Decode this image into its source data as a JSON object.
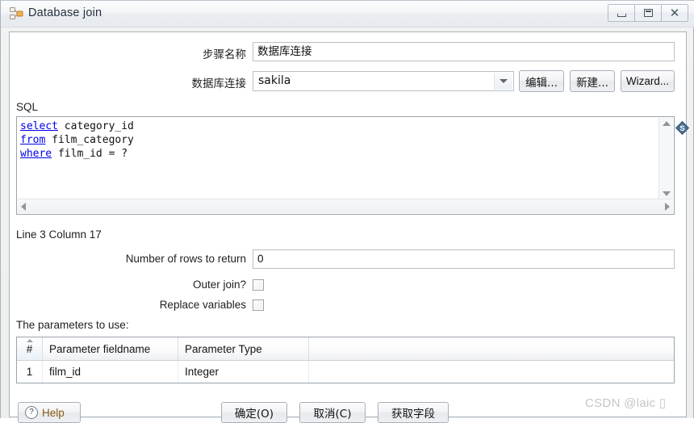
{
  "window": {
    "title": "Database join",
    "icon": "database-join-step-icon",
    "controls": [
      {
        "name": "minimize",
        "glyph": "—"
      },
      {
        "name": "maximize",
        "glyph": "□"
      },
      {
        "name": "close",
        "glyph": "✕"
      }
    ]
  },
  "form": {
    "step_name_label": "步骤名称",
    "step_name_value": "数据库连接",
    "connection_label": "数据库连接",
    "connection_value": "sakila",
    "connection_options": [
      "sakila"
    ],
    "edit_button": "编辑...",
    "new_button": "新建...",
    "wizard_button": "Wizard...",
    "sql_label": "SQL",
    "sql_lines": [
      {
        "keyword": "select",
        "rest": " category_id"
      },
      {
        "keyword": "from",
        "rest": " film_category"
      },
      {
        "keyword": "where",
        "rest": " film_id = ?"
      }
    ],
    "sql_plain": "select category_id\nfrom film_category\nwhere film_id = ?",
    "caret_status": "Line 3 Column 17",
    "variable_icon": "variable-dollar-icon",
    "rows_label": "Number of rows to return",
    "rows_value": "0",
    "outer_join_label": "Outer join?",
    "outer_join_checked": false,
    "replace_vars_label": "Replace variables",
    "replace_vars_checked": false,
    "parameters_label": "The parameters to use:"
  },
  "table": {
    "columns": [
      "#",
      "Parameter fieldname",
      "Parameter Type",
      ""
    ],
    "rows": [
      {
        "index": "1",
        "fieldname": "film_id",
        "type": "Integer",
        "extra": ""
      }
    ]
  },
  "footer": {
    "help_label": "Help",
    "ok_label": "确定(O)",
    "cancel_label": "取消(C)",
    "get_fields_label": "获取字段"
  },
  "watermark": "CSDN @laic ▯",
  "colors": {
    "keyword": "#0000ef",
    "accent_icon": "#3f6d99",
    "window_border": "#a7b3bf"
  }
}
